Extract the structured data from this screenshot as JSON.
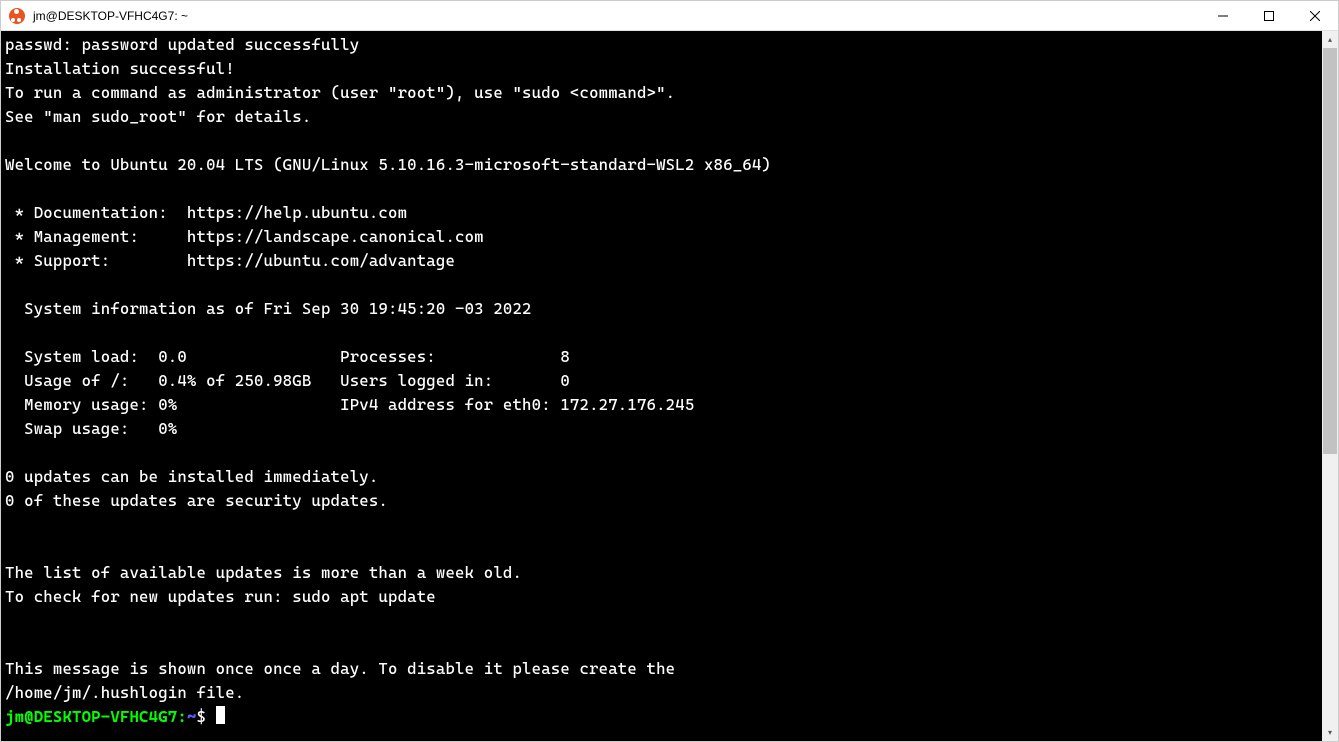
{
  "window": {
    "title": "jm@DESKTOP-VFHC4G7: ~"
  },
  "terminal": {
    "lines": [
      "passwd: password updated successfully",
      "Installation successful!",
      "To run a command as administrator (user \"root\"), use \"sudo <command>\".",
      "See \"man sudo_root\" for details.",
      "",
      "Welcome to Ubuntu 20.04 LTS (GNU/Linux 5.10.16.3-microsoft-standard-WSL2 x86_64)",
      "",
      " * Documentation:  https://help.ubuntu.com",
      " * Management:     https://landscape.canonical.com",
      " * Support:        https://ubuntu.com/advantage",
      "",
      "  System information as of Fri Sep 30 19:45:20 -03 2022",
      "",
      "  System load:  0.0                Processes:             8",
      "  Usage of /:   0.4% of 250.98GB   Users logged in:       0",
      "  Memory usage: 0%                 IPv4 address for eth0: 172.27.176.245",
      "  Swap usage:   0%",
      "",
      "0 updates can be installed immediately.",
      "0 of these updates are security updates.",
      "",
      "",
      "The list of available updates is more than a week old.",
      "To check for new updates run: sudo apt update",
      "",
      "",
      "This message is shown once once a day. To disable it please create the",
      "/home/jm/.hushlogin file."
    ],
    "prompt": {
      "user_host": "jm@DESKTOP-VFHC4G7",
      "separator": ":",
      "path": "~",
      "symbol": "$"
    }
  }
}
